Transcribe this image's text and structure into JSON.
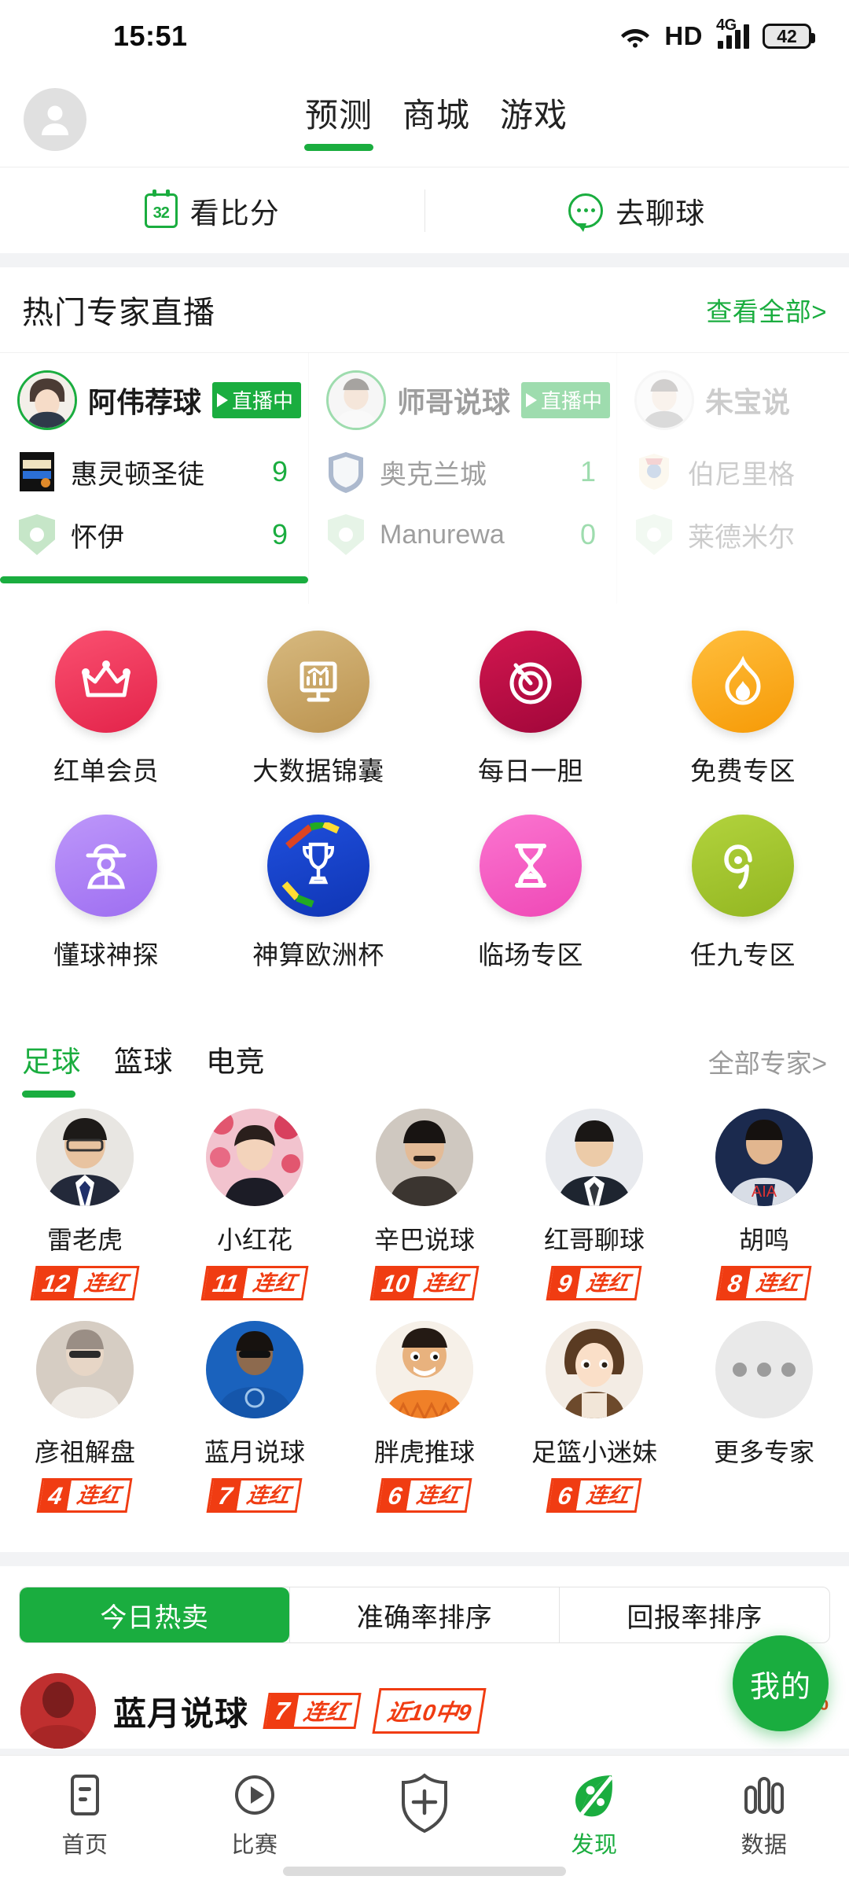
{
  "status_bar": {
    "time": "15:51",
    "hd_label": "HD",
    "network": "4G",
    "network_sup": "+",
    "battery": "42",
    "wifi_icon": "wifi-icon",
    "signal_icon": "signal-bars-icon",
    "battery_icon": "battery-icon"
  },
  "top_nav": {
    "avatar_icon": "user-avatar-icon",
    "tabs": [
      {
        "label": "预测",
        "active": true
      },
      {
        "label": "商城",
        "active": false
      },
      {
        "label": "游戏",
        "active": false
      }
    ]
  },
  "quick_bar": {
    "items": [
      {
        "label": "看比分",
        "icon": "scoreboard-icon",
        "badge": "32"
      },
      {
        "label": "去聊球",
        "icon": "chat-bubble-icon"
      }
    ]
  },
  "live_section": {
    "title": "热门专家直播",
    "more_label": "查看全部>",
    "cards": [
      {
        "expert": "阿伟荐球",
        "live_badge": "直播中",
        "teams": [
          {
            "name": "惠灵顿圣徒",
            "score": "9"
          },
          {
            "name": "怀伊",
            "score": "9"
          }
        ]
      },
      {
        "expert": "师哥说球",
        "live_badge": "直播中",
        "teams": [
          {
            "name": "奥克兰城",
            "score": "1"
          },
          {
            "name": "Manurewa",
            "score": "0"
          }
        ]
      },
      {
        "expert": "朱宝说",
        "live_badge": "",
        "teams": [
          {
            "name": "伯尼里格",
            "score": ""
          },
          {
            "name": "莱德米尔",
            "score": ""
          }
        ]
      }
    ]
  },
  "icon_grid": [
    {
      "label": "红单会员",
      "icon": "crown-icon",
      "color": "#f63e5e",
      "color2": "#e8254b"
    },
    {
      "label": "大数据锦囊",
      "icon": "chart-board-icon",
      "color": "#cdad74",
      "color2": "#bd9552"
    },
    {
      "label": "每日一胆",
      "icon": "target-icon",
      "color": "#c5114a",
      "color2": "#a3073d"
    },
    {
      "label": "免费专区",
      "icon": "flame-icon",
      "color": "#ffb42b",
      "color2": "#f59b08"
    },
    {
      "label": "懂球神探",
      "icon": "detective-icon",
      "color": "#b58cf7",
      "color2": "#9d6cf0"
    },
    {
      "label": "神算欧洲杯",
      "icon": "trophy-icon",
      "color": "#1746d6",
      "color2": "#0f35b4"
    },
    {
      "label": "临场专区",
      "icon": "hourglass-icon",
      "color": "#f967c9",
      "color2": "#ee46b6"
    },
    {
      "label": "任九专区",
      "icon": "nine-icon",
      "color": "#a6c832",
      "color2": "#93b621"
    }
  ],
  "expert_section": {
    "tabs": [
      {
        "label": "足球",
        "active": true
      },
      {
        "label": "篮球",
        "active": false
      },
      {
        "label": "电竞",
        "active": false
      }
    ],
    "all_label": "全部专家>",
    "streak_suffix": "连红",
    "experts": [
      {
        "name": "雷老虎",
        "streak": "12",
        "avatar_color": "#3a4456"
      },
      {
        "name": "小红花",
        "streak": "11",
        "avatar_color": "#d14a5e"
      },
      {
        "name": "辛巴说球",
        "streak": "10",
        "avatar_color": "#4c4440"
      },
      {
        "name": "红哥聊球",
        "streak": "9",
        "avatar_color": "#cfd3da"
      },
      {
        "name": "胡鸣",
        "streak": "8",
        "avatar_color": "#23305a"
      },
      {
        "name": "彦祖解盘",
        "streak": "4",
        "avatar_color": "#c9b9a8"
      },
      {
        "name": "蓝月说球",
        "streak": "7",
        "avatar_color": "#1b5fb8"
      },
      {
        "name": "胖虎推球",
        "streak": "6",
        "avatar_color": "#ef7a2e"
      },
      {
        "name": "足篮小迷妹",
        "streak": "6",
        "avatar_color": "#b08a6a"
      },
      {
        "name": "更多专家",
        "streak": "",
        "avatar_color": "#e9e9e9"
      }
    ]
  },
  "sort_tabs": [
    {
      "label": "今日热卖",
      "active": true
    },
    {
      "label": "准确率排序",
      "active": false
    },
    {
      "label": "回报率排序",
      "active": false
    }
  ],
  "featured_card": {
    "name": "蓝月说球",
    "streak_num": "7",
    "streak_text": "连红",
    "recent": "近10中9",
    "percent": "90",
    "percent_unit": "%"
  },
  "fab": {
    "label": "我的"
  },
  "bottom_nav": [
    {
      "label": "首页",
      "icon": "home-list-icon",
      "active": false
    },
    {
      "label": "比赛",
      "icon": "play-circle-icon",
      "active": false
    },
    {
      "label": "",
      "icon": "add-shield-icon",
      "active": false
    },
    {
      "label": "发现",
      "icon": "discover-leaf-icon",
      "active": true
    },
    {
      "label": "数据",
      "icon": "bar-chart-icon",
      "active": false
    }
  ]
}
